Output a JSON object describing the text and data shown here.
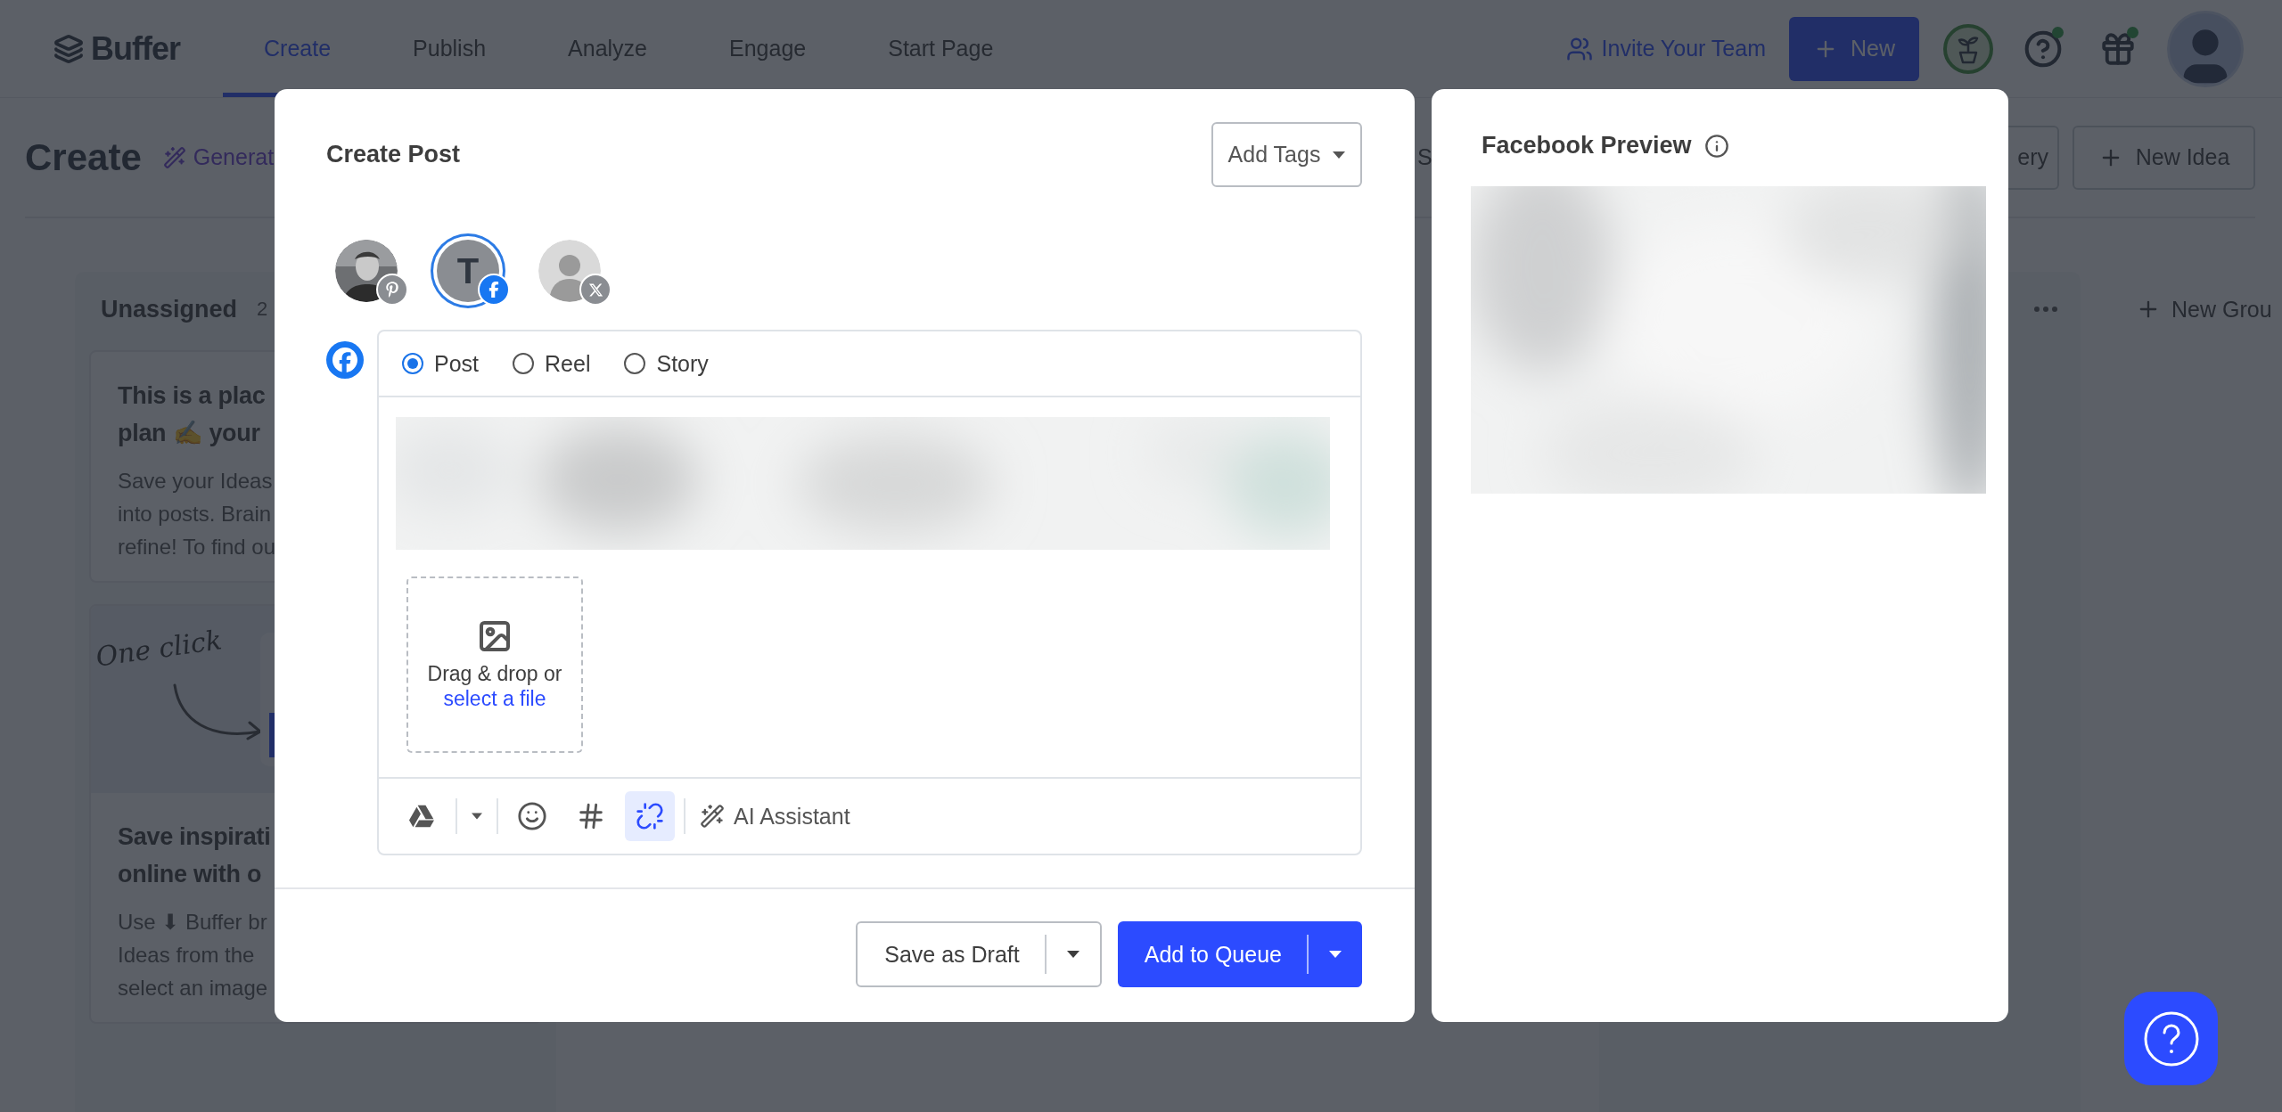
{
  "top_bar": {
    "logo": "Buffer",
    "tabs": [
      {
        "label": "Create",
        "selected": true
      },
      {
        "label": "Publish",
        "selected": false
      },
      {
        "label": "Analyze",
        "selected": false
      },
      {
        "label": "Engage",
        "selected": false
      },
      {
        "label": "Start Page",
        "selected": false
      }
    ],
    "invite": "Invite Your Team",
    "new_button": "New",
    "icons": [
      {
        "kind": "plant",
        "dot": false
      },
      {
        "kind": "help",
        "dot": true
      },
      {
        "kind": "gift",
        "dot": true
      }
    ]
  },
  "page_header": {
    "title": "Create",
    "generate": "Generat",
    "fragment": "S",
    "gallery_fragment": "ery",
    "new_idea": "New Idea"
  },
  "board": {
    "columns": [
      {
        "title": "Unassigned",
        "count": "2",
        "cards": [
          {
            "kind": "text",
            "title_lines": [
              "This is a plac",
              "plan ✍ your"
            ],
            "body_lines": [
              "Save your Ideas",
              "into posts. Brain",
              "refine! To find ou"
            ]
          },
          {
            "kind": "illustrated",
            "caption": "One click",
            "title_lines": [
              "Save inspirati",
              "online with o"
            ],
            "body_lines": [
              "Use ⬇ Buffer br",
              "Ideas from the",
              "select an image"
            ]
          }
        ]
      }
    ],
    "new_group": "New Grou"
  },
  "composer": {
    "title": "Create Post",
    "add_tags": "Add Tags",
    "accounts": [
      {
        "badge": {
          "kind": "pinterest"
        },
        "selected": false
      },
      {
        "kind": "letter",
        "initial": "T",
        "badge": {
          "kind": "facebook"
        },
        "selected": true
      },
      {
        "kind": "blank",
        "badge": {
          "kind": "x"
        },
        "selected": false
      }
    ],
    "channel": {
      "kind": "facebook"
    },
    "post_types": [
      {
        "label": "Post",
        "selected": true
      },
      {
        "label": "Reel",
        "selected": false
      },
      {
        "label": "Story",
        "selected": false
      }
    ],
    "drop_zone": {
      "text": "Drag & drop or",
      "link": "select a file"
    },
    "tools": [
      {
        "kind": "drive",
        "active": false
      },
      {
        "kind": "emoji",
        "active": false
      },
      {
        "kind": "hashtag",
        "active": false
      },
      {
        "kind": "shortener",
        "active": true
      }
    ],
    "ai_assistant": "AI Assistant",
    "save_draft": "Save as Draft",
    "add_to_queue": "Add to Queue"
  },
  "preview": {
    "title": "Facebook Preview"
  }
}
